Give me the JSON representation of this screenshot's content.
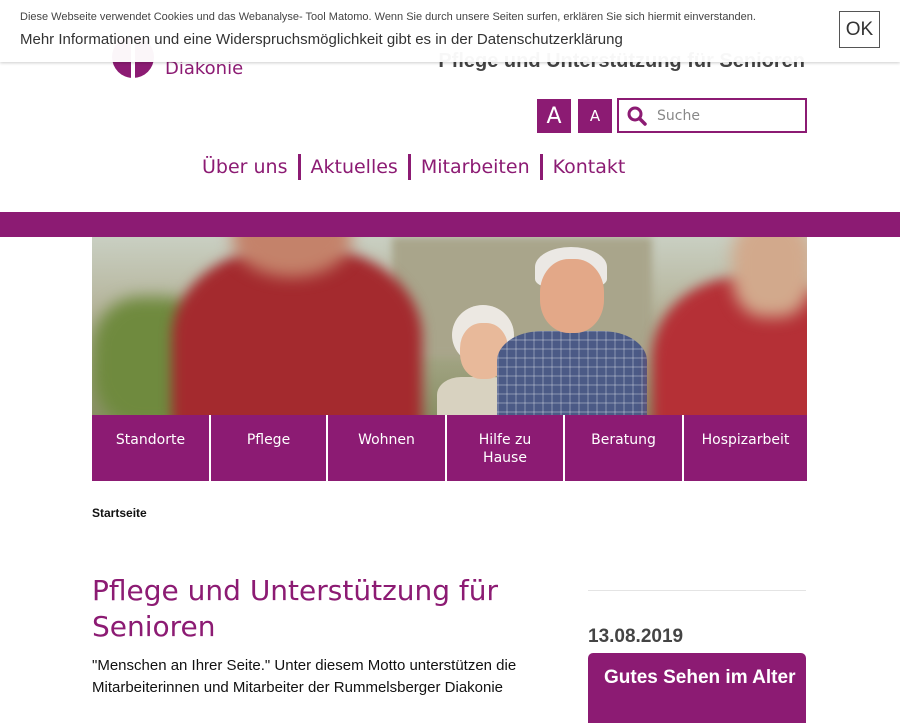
{
  "brand": {
    "logo_text": "Diakonie",
    "tagline": "Pflege und Unterstützung für Senioren",
    "accent_color": "#8c1b73"
  },
  "cookie_notice": {
    "line1": "Diese Webseite verwendet Cookies und das Webanalyse- Tool Matomo. Wenn Sie durch unsere Seiten surfen, erklären Sie sich hiermit einverstanden.",
    "line2": "Mehr Informationen und eine Widerspruchsmöglichkeit gibt es in der Datenschutzerklärung",
    "ok_label": "OK"
  },
  "accessibility": {
    "font_large_label": "A",
    "font_small_label": "A"
  },
  "search": {
    "placeholder": "Suche",
    "icon": "search-icon"
  },
  "main_nav": [
    {
      "label": "Über uns"
    },
    {
      "label": "Aktuelles"
    },
    {
      "label": "Mitarbeiten"
    },
    {
      "label": "Kontakt"
    }
  ],
  "sub_nav": [
    {
      "label": "Standorte"
    },
    {
      "label": "Pflege"
    },
    {
      "label": "Wohnen"
    },
    {
      "label": "Hilfe zu Hause"
    },
    {
      "label": "Beratung"
    },
    {
      "label": "Hospizarbeit"
    }
  ],
  "breadcrumb": {
    "home": "Startseite"
  },
  "main": {
    "title": "Pflege und Unterstützung für Senioren",
    "intro": "\"Menschen an Ihrer Seite.\" Unter diesem Motto unterstützen die Mitarbeiterinnen und Mitarbeiter der Rummelsberger Diakonie"
  },
  "sidebar": {
    "news_date": "13.08.2019",
    "news_title": "Gutes Sehen im Alter"
  }
}
